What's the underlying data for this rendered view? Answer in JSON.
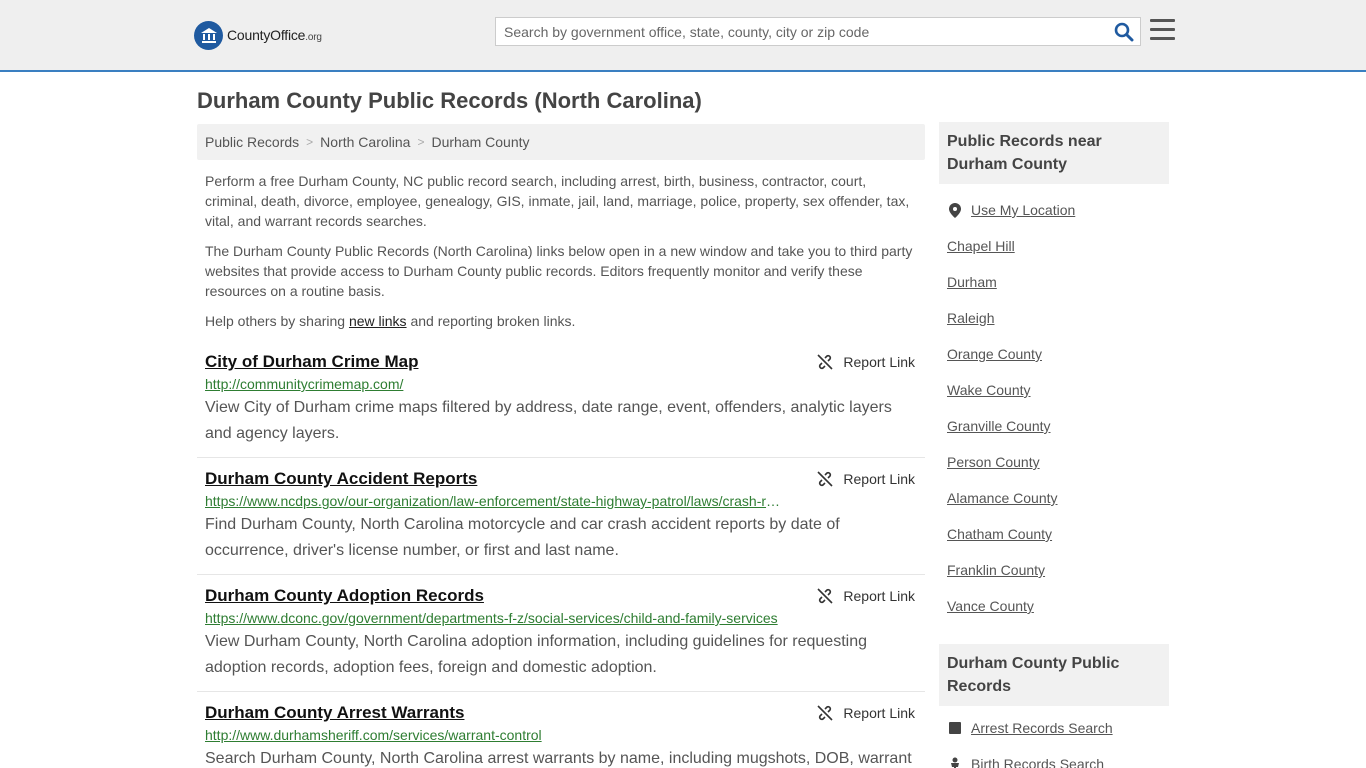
{
  "header": {
    "logo_brand": "CountyOffice",
    "logo_tld": ".org",
    "search_placeholder": "Search by government office, state, county, city or zip code"
  },
  "page_title": "Durham County Public Records (North Carolina)",
  "breadcrumb": [
    "Public Records",
    "North Carolina",
    "Durham County"
  ],
  "intro": {
    "p1": "Perform a free Durham County, NC public record search, including arrest, birth, business, contractor, court, criminal, death, divorce, employee, genealogy, GIS, inmate, jail, land, marriage, police, property, sex offender, tax, vital, and warrant records searches.",
    "p2": "The Durham County Public Records (North Carolina) links below open in a new window and take you to third party websites that provide access to Durham County public records. Editors frequently monitor and verify these resources on a routine basis.",
    "p3_before": "Help others by sharing ",
    "p3_link": "new links",
    "p3_after": " and reporting broken links."
  },
  "report_label": "Report Link",
  "records": [
    {
      "title": "City of Durham Crime Map",
      "url": "http://communitycrimemap.com/",
      "desc": "View City of Durham crime maps filtered by address, date range, event, offenders, analytic layers and agency layers."
    },
    {
      "title": "Durham County Accident Reports",
      "url": "https://www.ncdps.gov/our-organization/law-enforcement/state-highway-patrol/laws/crash-reports",
      "desc": "Find Durham County, North Carolina motorcycle and car crash accident reports by date of occurrence, driver's license number, or first and last name."
    },
    {
      "title": "Durham County Adoption Records",
      "url": "https://www.dconc.gov/government/departments-f-z/social-services/child-and-family-services",
      "desc": "View Durham County, North Carolina adoption information, including guidelines for requesting adoption records, adoption fees, foreign and domestic adoption."
    },
    {
      "title": "Durham County Arrest Warrants",
      "url": "http://www.durhamsheriff.com/services/warrant-control",
      "desc": "Search Durham County, North Carolina arrest warrants by name, including mugshots, DOB, warrant"
    }
  ],
  "sidebar": {
    "nearby_heading": "Public Records near Durham County",
    "use_location": "Use My Location",
    "nearby": [
      "Chapel Hill",
      "Durham",
      "Raleigh",
      "Orange County",
      "Wake County",
      "Granville County",
      "Person County",
      "Alamance County",
      "Chatham County",
      "Franklin County",
      "Vance County"
    ],
    "records_heading": "Durham County Public Records",
    "record_links": [
      "Arrest Records Search",
      "Birth Records Search"
    ]
  },
  "colors": {
    "accent": "#3a7fc1",
    "url_green": "#2e7d32",
    "logo_blue": "#1f5aa0"
  }
}
